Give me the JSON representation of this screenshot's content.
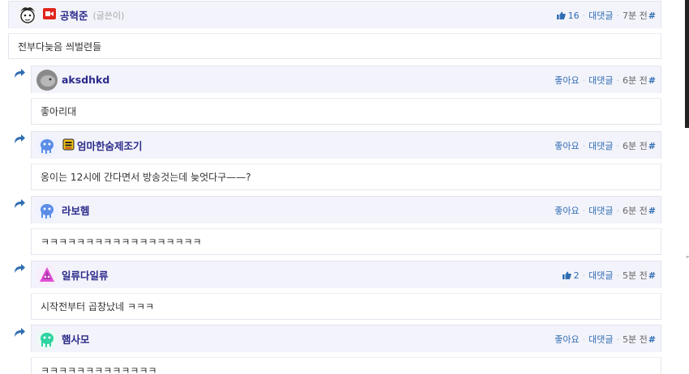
{
  "colors": {
    "header_bg": "#f3f3fb",
    "nick": "#2b2b8a",
    "link": "#2f6db3"
  },
  "actions": {
    "like": "좋아요",
    "reply": "대댓글",
    "hash": "#"
  },
  "comments": [
    {
      "nick": "공혁준",
      "author_tag": "(글쓴이)",
      "likes": "16",
      "time": "7분 전",
      "text": "전부다늦음 씌벌련들",
      "avatar": "sketch-face",
      "badges": [
        "video-badge"
      ]
    },
    {
      "nick": "aksdhkd",
      "likes": "",
      "time": "6분 전",
      "text": "좋아리대",
      "avatar": "gray-blob"
    },
    {
      "nick": "엄마한숨제조기",
      "likes": "",
      "time": "6분 전",
      "text": "옹이는 12시에 간다면서 방송것는데 늦엇다구——?",
      "avatar": "blue-bug",
      "badges": [
        "sub-badge"
      ]
    },
    {
      "nick": "라보헴",
      "likes": "",
      "time": "6분 전",
      "text": "ㅋㅋㅋㅋㅋㅋㅋㅋㅋㅋㅋㅋㅋㅋㅋㅋㅋㅋ",
      "avatar": "blue-bug"
    },
    {
      "nick": "일류다일류",
      "likes": "2",
      "time": "5분 전",
      "text": "시작전부터 곱창났네 ㅋㅋㅋ",
      "avatar": "pink-triangle"
    },
    {
      "nick": "햄사모",
      "likes": "",
      "time": "5분 전",
      "text": "ㅋㅋㅋㅋㅋㅋㅋㅋㅋㅋㅋㅋㅋ",
      "avatar": "green-bug"
    }
  ]
}
